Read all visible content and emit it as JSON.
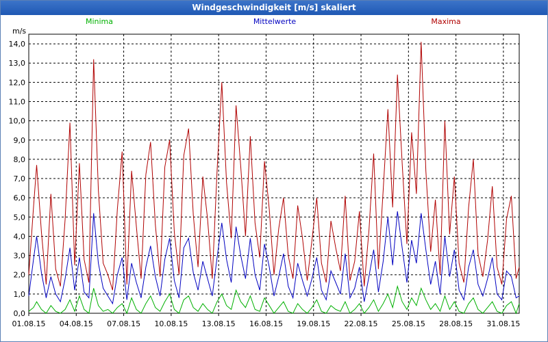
{
  "window": {
    "title": "Windgeschwindigkeit [m/s] skaliert"
  },
  "chart_data": {
    "type": "line",
    "title": "Windgeschwindigkeit [m/s] skaliert",
    "ylabel": "m/s",
    "xlabel": "",
    "ylim": [
      0,
      14.5
    ],
    "xlim": [
      0,
      31
    ],
    "grid": true,
    "legend_placement": "top",
    "y_ticks": [
      "0,0",
      "1,0",
      "2,0",
      "3,0",
      "4,0",
      "5,0",
      "6,0",
      "7,0",
      "8,0",
      "9,0",
      "10,0",
      "11,0",
      "12,0",
      "13,0",
      "14,0"
    ],
    "x_ticks": [
      {
        "label": "01.08.15",
        "x": 0
      },
      {
        "label": "04.08.15",
        "x": 3
      },
      {
        "label": "07.08.15",
        "x": 6
      },
      {
        "label": "10.08.15",
        "x": 9
      },
      {
        "label": "13.08.15",
        "x": 12
      },
      {
        "label": "16.08.15",
        "x": 15
      },
      {
        "label": "19.08.15",
        "x": 18
      },
      {
        "label": "22.08.15",
        "x": 21
      },
      {
        "label": "25.08.15",
        "x": 24
      },
      {
        "label": "28.08.15",
        "x": 27
      },
      {
        "label": "31.08.15",
        "x": 30
      }
    ],
    "series": [
      {
        "name": "Minima",
        "color": "#00b000",
        "x": [
          0,
          0.3,
          0.5,
          0.8,
          1.1,
          1.4,
          1.7,
          2.0,
          2.3,
          2.6,
          2.9,
          3.2,
          3.5,
          3.8,
          4.1,
          4.4,
          4.7,
          5.0,
          5.3,
          5.6,
          5.9,
          6.2,
          6.5,
          6.8,
          7.1,
          7.4,
          7.7,
          8.0,
          8.3,
          8.6,
          8.9,
          9.2,
          9.5,
          9.8,
          10.1,
          10.4,
          10.7,
          11.0,
          11.3,
          11.6,
          11.9,
          12.2,
          12.5,
          12.8,
          13.1,
          13.4,
          13.7,
          14.0,
          14.3,
          14.6,
          14.9,
          15.2,
          15.5,
          15.8,
          16.1,
          16.4,
          16.7,
          17.0,
          17.3,
          17.6,
          17.9,
          18.2,
          18.5,
          18.8,
          19.1,
          19.4,
          19.7,
          20.0,
          20.3,
          20.6,
          20.9,
          21.2,
          21.5,
          21.8,
          22.1,
          22.4,
          22.7,
          23.0,
          23.3,
          23.6,
          23.9,
          24.2,
          24.5,
          24.8,
          25.1,
          25.4,
          25.7,
          26.0,
          26.3,
          26.6,
          26.9,
          27.2,
          27.5,
          27.8,
          28.1,
          28.4,
          28.7,
          29.0,
          29.3,
          29.6,
          29.9,
          30.2,
          30.5,
          30.8,
          31.0
        ],
        "values": [
          0.1,
          0.3,
          0.6,
          0.2,
          0.0,
          0.4,
          0.1,
          0.0,
          0.2,
          0.7,
          0.1,
          0.9,
          0.2,
          0.0,
          1.3,
          0.4,
          0.1,
          0.2,
          0.0,
          0.3,
          0.5,
          0.0,
          0.8,
          0.2,
          0.0,
          0.5,
          0.9,
          0.3,
          0.1,
          0.6,
          1.0,
          0.2,
          0.0,
          0.7,
          0.9,
          0.3,
          0.1,
          0.5,
          0.2,
          0.0,
          0.6,
          1.0,
          0.4,
          0.2,
          1.2,
          0.6,
          0.3,
          0.9,
          0.2,
          0.1,
          0.8,
          0.4,
          0.0,
          0.3,
          0.6,
          0.1,
          0.0,
          0.5,
          0.2,
          0.0,
          0.3,
          0.7,
          0.1,
          0.0,
          0.4,
          0.2,
          0.1,
          0.6,
          0.0,
          0.2,
          0.5,
          0.0,
          0.3,
          0.7,
          0.1,
          0.5,
          1.0,
          0.3,
          1.4,
          0.6,
          0.2,
          0.8,
          0.4,
          1.3,
          0.7,
          0.2,
          0.5,
          0.1,
          0.9,
          0.2,
          0.6,
          0.1,
          0.0,
          0.5,
          0.8,
          0.2,
          0.0,
          0.3,
          0.6,
          0.1,
          0.0,
          0.4,
          0.6,
          0.0,
          0.5
        ]
      },
      {
        "name": "Mittelwerte",
        "color": "#0000c0",
        "x": [
          0,
          0.3,
          0.5,
          0.8,
          1.1,
          1.4,
          1.7,
          2.0,
          2.3,
          2.6,
          2.9,
          3.2,
          3.5,
          3.8,
          4.1,
          4.4,
          4.7,
          5.0,
          5.3,
          5.6,
          5.9,
          6.2,
          6.5,
          6.8,
          7.1,
          7.4,
          7.7,
          8.0,
          8.3,
          8.6,
          8.9,
          9.2,
          9.5,
          9.8,
          10.1,
          10.4,
          10.7,
          11.0,
          11.3,
          11.6,
          11.9,
          12.2,
          12.5,
          12.8,
          13.1,
          13.4,
          13.7,
          14.0,
          14.3,
          14.6,
          14.9,
          15.2,
          15.5,
          15.8,
          16.1,
          16.4,
          16.7,
          17.0,
          17.3,
          17.6,
          17.9,
          18.2,
          18.5,
          18.8,
          19.1,
          19.4,
          19.7,
          20.0,
          20.3,
          20.6,
          20.9,
          21.2,
          21.5,
          21.8,
          22.1,
          22.4,
          22.7,
          23.0,
          23.3,
          23.6,
          23.9,
          24.2,
          24.5,
          24.8,
          25.1,
          25.4,
          25.7,
          26.0,
          26.3,
          26.6,
          26.9,
          27.2,
          27.5,
          27.8,
          28.1,
          28.4,
          28.7,
          29.0,
          29.3,
          29.6,
          29.9,
          30.2,
          30.5,
          30.8,
          31.0
        ],
        "values": [
          0.9,
          2.8,
          4.0,
          2.1,
          0.8,
          1.9,
          1.0,
          0.6,
          1.8,
          3.4,
          1.2,
          2.9,
          1.1,
          0.8,
          5.2,
          2.6,
          1.3,
          0.9,
          0.5,
          2.0,
          2.9,
          0.7,
          2.6,
          1.6,
          0.8,
          2.4,
          3.5,
          1.9,
          0.9,
          2.8,
          3.9,
          1.7,
          0.8,
          3.4,
          3.9,
          2.1,
          1.2,
          2.7,
          1.8,
          0.9,
          2.9,
          4.7,
          2.8,
          1.6,
          4.5,
          3.0,
          1.8,
          3.9,
          2.0,
          1.2,
          3.6,
          2.4,
          0.9,
          1.9,
          3.1,
          1.4,
          0.8,
          2.6,
          1.7,
          0.9,
          1.8,
          2.9,
          1.2,
          0.7,
          2.2,
          1.6,
          1.0,
          3.1,
          0.8,
          1.3,
          2.4,
          0.6,
          1.9,
          3.3,
          1.1,
          2.7,
          5.0,
          2.5,
          5.3,
          3.4,
          1.6,
          3.8,
          2.6,
          5.2,
          3.3,
          1.5,
          2.7,
          1.0,
          4.0,
          1.9,
          3.3,
          1.2,
          0.7,
          2.4,
          3.3,
          1.5,
          0.9,
          1.8,
          2.9,
          1.0,
          0.7,
          2.2,
          1.9,
          0.8,
          0.9
        ]
      },
      {
        "name": "Maxima",
        "color": "#b00000",
        "x": [
          0,
          0.3,
          0.5,
          0.8,
          1.1,
          1.4,
          1.7,
          2.0,
          2.3,
          2.6,
          2.9,
          3.2,
          3.5,
          3.8,
          4.1,
          4.4,
          4.7,
          5.0,
          5.3,
          5.6,
          5.9,
          6.2,
          6.5,
          6.8,
          7.1,
          7.4,
          7.7,
          8.0,
          8.3,
          8.6,
          8.9,
          9.2,
          9.5,
          9.8,
          10.1,
          10.4,
          10.7,
          11.0,
          11.3,
          11.6,
          11.9,
          12.2,
          12.5,
          12.8,
          13.1,
          13.4,
          13.7,
          14.0,
          14.3,
          14.6,
          14.9,
          15.2,
          15.5,
          15.8,
          16.1,
          16.4,
          16.7,
          17.0,
          17.3,
          17.6,
          17.9,
          18.2,
          18.5,
          18.8,
          19.1,
          19.4,
          19.7,
          20.0,
          20.3,
          20.6,
          20.9,
          21.2,
          21.5,
          21.8,
          22.1,
          22.4,
          22.7,
          23.0,
          23.3,
          23.6,
          23.9,
          24.2,
          24.5,
          24.8,
          25.1,
          25.4,
          25.7,
          26.0,
          26.3,
          26.6,
          26.9,
          27.2,
          27.5,
          27.8,
          28.1,
          28.4,
          28.7,
          29.0,
          29.3,
          29.6,
          29.9,
          30.2,
          30.5,
          30.8,
          31.0
        ],
        "values": [
          2.0,
          5.5,
          7.7,
          4.2,
          1.5,
          6.2,
          2.3,
          1.4,
          4.9,
          9.9,
          2.5,
          7.8,
          2.8,
          1.6,
          13.2,
          6.4,
          2.6,
          2.0,
          1.2,
          5.4,
          8.4,
          1.5,
          7.4,
          4.5,
          1.8,
          7.2,
          8.9,
          4.6,
          1.9,
          7.6,
          9.0,
          4.2,
          2.0,
          8.2,
          9.6,
          5.1,
          2.4,
          7.1,
          4.9,
          1.8,
          7.4,
          12.0,
          6.8,
          3.9,
          10.8,
          7.6,
          4.0,
          9.2,
          4.7,
          2.9,
          7.9,
          5.4,
          2.0,
          4.4,
          6.0,
          3.0,
          1.8,
          5.6,
          3.9,
          1.7,
          3.8,
          6.0,
          2.6,
          1.6,
          4.8,
          3.4,
          2.2,
          6.1,
          1.7,
          2.7,
          5.3,
          1.4,
          4.3,
          8.3,
          2.3,
          6.4,
          10.6,
          5.5,
          12.4,
          7.8,
          3.6,
          9.4,
          6.2,
          14.1,
          7.4,
          3.2,
          5.9,
          2.0,
          10.0,
          4.1,
          7.1,
          2.6,
          1.6,
          5.5,
          8.0,
          3.1,
          1.9,
          3.8,
          6.6,
          2.4,
          1.5,
          4.9,
          6.1,
          1.8,
          2.4
        ]
      }
    ]
  }
}
